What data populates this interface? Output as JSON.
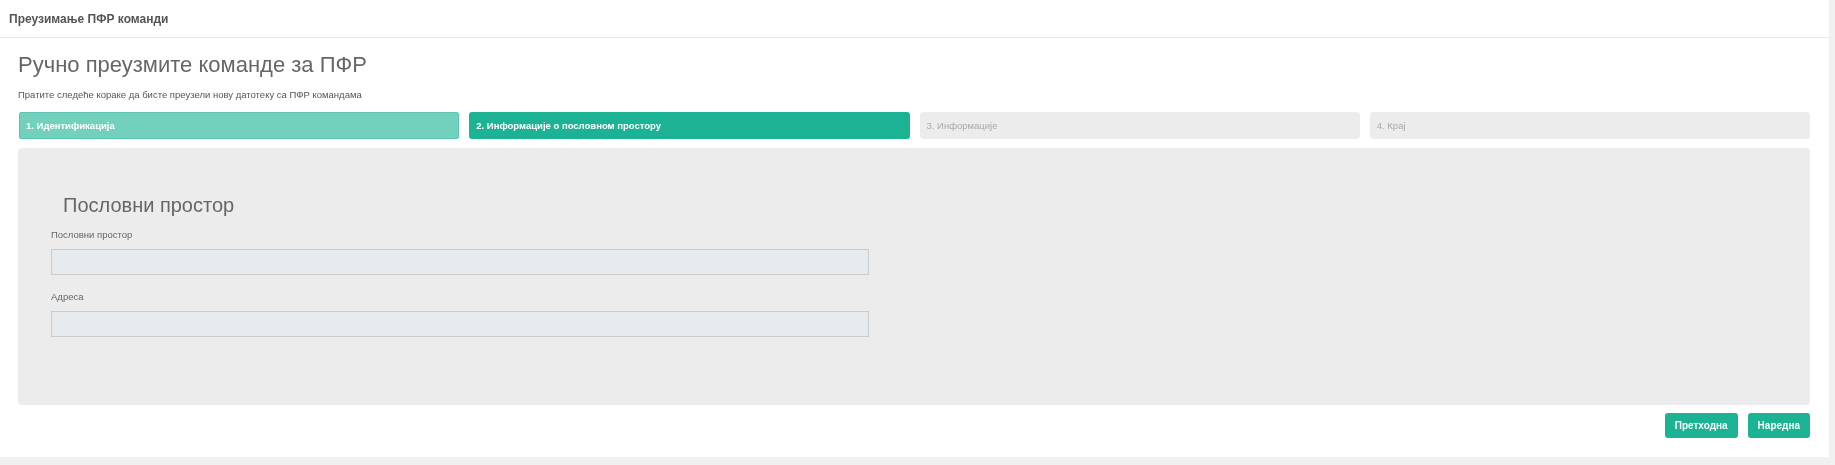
{
  "header": {
    "title": "Преузимање ПФР команди"
  },
  "page": {
    "title": "Ручно преузмите команде за ПФР",
    "subtitle": "Пратите следеће кораке да бисте преузели нову датотеку са ПФР командама"
  },
  "steps": [
    {
      "label": "1. Идентификација",
      "selected": false,
      "done": true
    },
    {
      "label": "2. Информације о пословном простору",
      "selected": true,
      "done": false
    },
    {
      "label": "3. Информације",
      "selected": false,
      "done": false
    },
    {
      "label": "4. Крај",
      "selected": false,
      "done": false
    }
  ],
  "section": {
    "title": "Пословни простор",
    "fields": [
      {
        "label": "Пословни простор"
      },
      {
        "label": "Адреса"
      }
    ]
  },
  "buttons": [
    {
      "label": "Претходна"
    },
    {
      "label": "Наредна"
    }
  ]
}
